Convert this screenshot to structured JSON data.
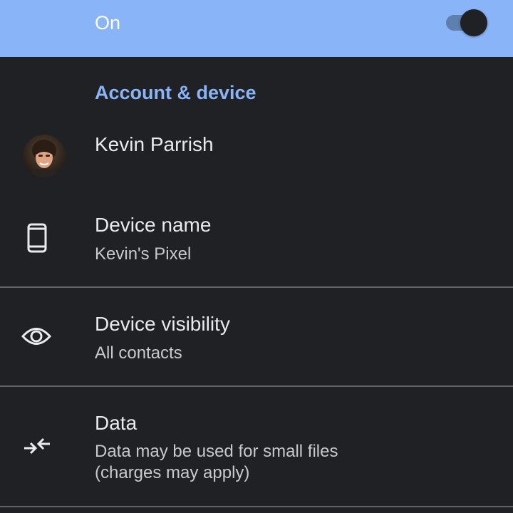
{
  "master_toggle": {
    "label": "On",
    "state": "on"
  },
  "section": {
    "header": "Account & device"
  },
  "account": {
    "name": "Kevin Parrish",
    "avatar_icon": "user-avatar"
  },
  "device_name": {
    "title": "Device name",
    "value": "Kevin's Pixel",
    "icon": "phone-icon"
  },
  "device_visibility": {
    "title": "Device visibility",
    "value": "All contacts",
    "icon": "eye-icon"
  },
  "data_usage": {
    "title": "Data",
    "value_line1": "Data may be used for small files",
    "value_line2": "(charges may apply)",
    "icon": "data-transfer-icon"
  },
  "colors": {
    "accent": "#8ab4f8",
    "background": "#202124",
    "text_primary": "#e8eaed",
    "text_secondary": "#c7c9cc",
    "divider": "#5f6368"
  }
}
